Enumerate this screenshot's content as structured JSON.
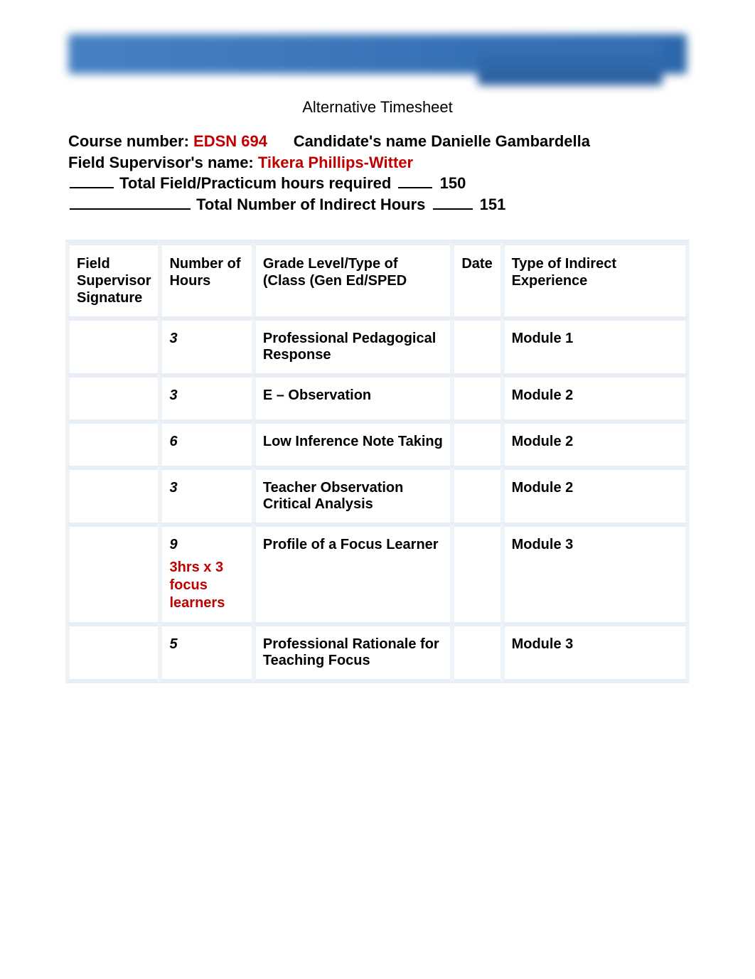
{
  "banner": {
    "tab_text": ""
  },
  "subtitle": "Alternative Timesheet",
  "info": {
    "course_number_label": "Course number: ",
    "course_number_value": "EDSN 694",
    "candidate_label": "Candidate's name ",
    "candidate_value": "Danielle Gambardella",
    "supervisor_label": "Field Supervisor's name: ",
    "supervisor_value": "Tikera Phillips-Witter",
    "total_field_label": "Total Field/Practicum hours required ",
    "total_field_value": "150",
    "total_indirect_label": "Total Number of Indirect Hours ",
    "total_indirect_value": "151"
  },
  "headers": {
    "col1": "Field Supervisor Signature",
    "col2": "Number of Hours",
    "col3_line1": "Grade Level/Type of",
    "col3_line2": "Class (Gen Ed/SPED",
    "col4": "Date",
    "col5": "Type of Indirect Experience"
  },
  "rows": [
    {
      "signature": "",
      "hours": "3",
      "hours_sub": "",
      "grade": "Professional Pedagogical Response",
      "date": "",
      "type": "Module 1"
    },
    {
      "signature": "",
      "hours": "3",
      "hours_sub": "",
      "grade": "E – Observation",
      "date": "",
      "type": "Module 2"
    },
    {
      "signature": "",
      "hours": "6",
      "hours_sub": "",
      "grade": "Low Inference Note Taking",
      "date": "",
      "type": "Module 2"
    },
    {
      "signature": "",
      "hours": "3",
      "hours_sub": "",
      "grade": "Teacher Observation Critical Analysis",
      "date": "",
      "type": "Module 2"
    },
    {
      "signature": "",
      "hours": "9",
      "hours_sub": "3hrs x 3 focus learners",
      "grade": "Profile of a Focus Learner",
      "date": "",
      "type": "Module 3"
    },
    {
      "signature": "",
      "hours": "5",
      "hours_sub": "",
      "grade": "Professional Rationale for Teaching Focus",
      "date": "",
      "type": "Module 3"
    }
  ]
}
